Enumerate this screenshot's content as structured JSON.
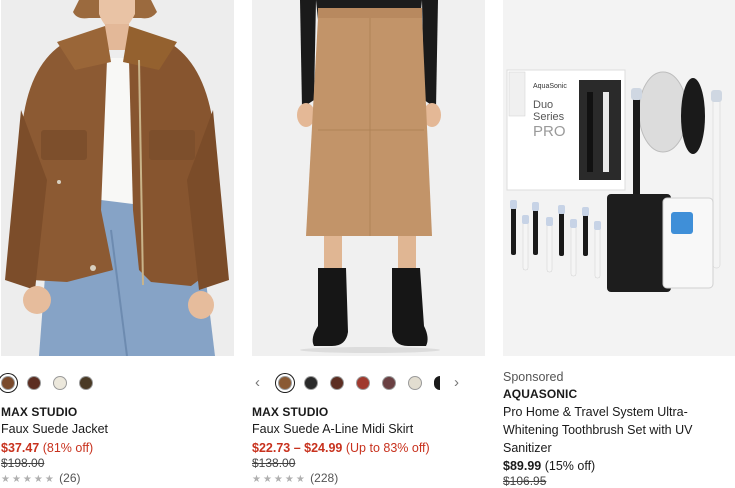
{
  "products": [
    {
      "image_icon": "jacket-photo",
      "swatch_colors": [
        "#7a4a2c",
        "#5c2e22",
        "#ece8dc",
        "#4a3a26"
      ],
      "brand": "MAX STUDIO",
      "title": "Faux Suede Jacket",
      "price": "$37.47",
      "discount": "(81% off)",
      "original_price": "$198.00",
      "rating_count": "(26)"
    },
    {
      "image_icon": "skirt-photo",
      "swatch_colors": [
        "#8a5a34",
        "#2a2a2a",
        "#5c2e22",
        "#a03a2e",
        "#6a4042",
        "#e2ddd0"
      ],
      "brand": "MAX STUDIO",
      "title": "Faux Suede A-Line Midi Skirt",
      "price": "$22.73 – $24.99",
      "discount": "(Up to 83% off)",
      "original_price": "$138.00",
      "rating_count": "(228)"
    },
    {
      "image_icon": "toothbrush-set-photo",
      "sponsored_label": "Sponsored",
      "brand": "AQUASONIC",
      "title": "Pro Home & Travel System Ultra-Whitening Toothbrush Set with UV Sanitizer",
      "price": "$89.99",
      "discount": "(15% off)",
      "original_price": "$106.95",
      "box_brand": "AquaSonic",
      "box_line1": "Duo",
      "box_line2": "Series",
      "box_line3": "PRO"
    }
  ],
  "icons": {
    "prev": "‹",
    "next": "›",
    "stars": "★★★★★"
  }
}
